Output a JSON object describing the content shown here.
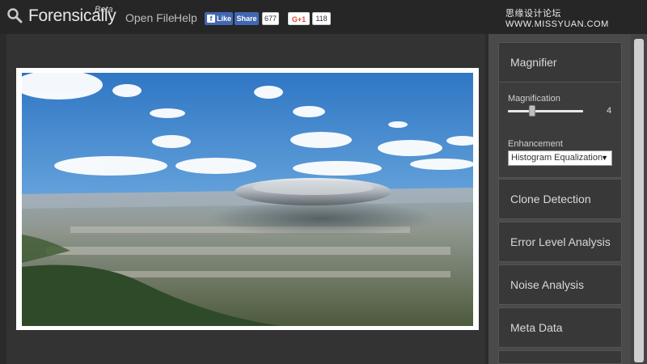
{
  "header": {
    "brand": "Forensically",
    "beta": "Beta",
    "nav": {
      "open_file": "Open File",
      "help": "Help"
    },
    "facebook": {
      "like_label": "Like",
      "share_label": "Share",
      "count": "677"
    },
    "google_plus": {
      "label": "G+1",
      "count": "118"
    },
    "watermark": "思缘设计论坛 WWW.MISSYUAN.COM",
    "icons": {
      "logo": "magnifier-icon",
      "facebook": "facebook-icon"
    }
  },
  "sidebar": {
    "magnifier": {
      "title": "Magnifier",
      "magnification_label": "Magnification",
      "magnification_value": "4",
      "magnification_level": 0.32,
      "enhancement_label": "Enhancement",
      "enhancement_selected": "Histogram Equalization"
    },
    "tools": [
      "Clone Detection",
      "Error Level Analysis",
      "Noise Analysis",
      "Meta Data"
    ]
  },
  "colors": {
    "background": "#2b2b2b",
    "panel": "#383838",
    "facebook": "#4267b2",
    "gplus": "#dd4b39"
  }
}
